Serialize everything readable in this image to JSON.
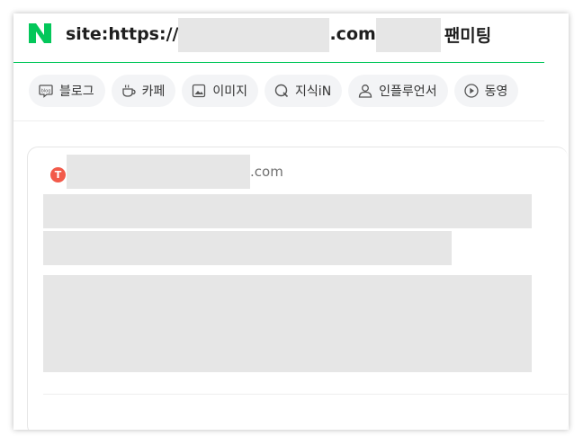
{
  "search": {
    "prefix": "site:https://",
    "tld": ".com",
    "suffix": "팬미팅"
  },
  "tabs": [
    {
      "label": "블로그",
      "icon": "blog-icon"
    },
    {
      "label": "카페",
      "icon": "cafe-cup-icon"
    },
    {
      "label": "이미지",
      "icon": "image-icon"
    },
    {
      "label": "지식iN",
      "icon": "knowledge-q-icon"
    },
    {
      "label": "인플루언서",
      "icon": "person-icon"
    },
    {
      "label": "동영",
      "icon": "play-icon"
    }
  ],
  "result": {
    "site_tld": ".com",
    "favicon_letter": "T"
  },
  "colors": {
    "brand_green": "#03c75a",
    "favicon_red": "#f25a4a",
    "redaction_gray": "#e6e6e6"
  }
}
